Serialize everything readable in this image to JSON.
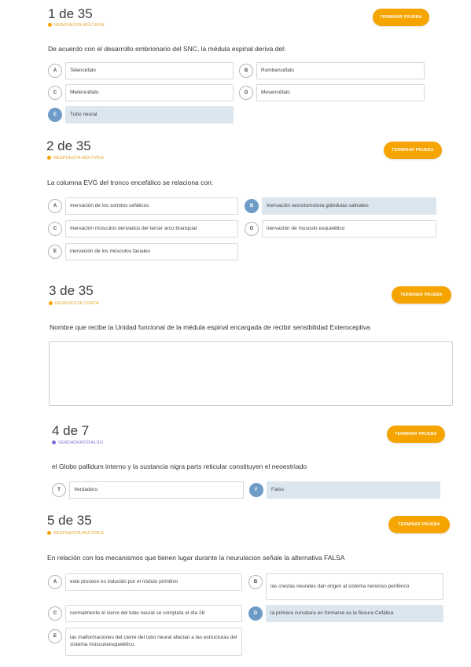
{
  "colors": {
    "accent": "#f5a400",
    "selected_circle": "#6e9bc7",
    "selected_bg": "#dce6ef",
    "truefalse_dot": "#7b6fd4"
  },
  "questions": [
    {
      "number": "1 de 35",
      "type": "RESPUESTA MÚLTIPLE",
      "button": "TERMINAR PRUEBA",
      "prompt": "De acuerdo con el desarrollo embrionario del SNC,  la médula espinal deriva del:",
      "options": [
        {
          "letter": "A",
          "text": "Telencéfalo",
          "selected": false
        },
        {
          "letter": "B",
          "text": "Rombencéfalo",
          "selected": false
        },
        {
          "letter": "C",
          "text": "Mielencéfalo",
          "selected": false
        },
        {
          "letter": "D",
          "text": "Mesencéfalo",
          "selected": false
        },
        {
          "letter": "E",
          "text": "Tubo neural",
          "selected": true
        }
      ]
    },
    {
      "number": "2 de 35",
      "type": "RESPUESTA MÚLTIPLE",
      "button": "TERMINAR PRUEBA",
      "prompt": "La columna EVG del tronco encefálico se relaciona con:",
      "options": [
        {
          "letter": "A",
          "text": "Inervación de los somitos cefálicos",
          "selected": false
        },
        {
          "letter": "B",
          "text": "Inervación secretomotora glándulas salivales",
          "selected": true
        },
        {
          "letter": "C",
          "text": "Inervación músculos derivados del tercer arco branquial",
          "selected": false
        },
        {
          "letter": "D",
          "text": "inervación de musculo esquelético",
          "selected": false
        },
        {
          "letter": "E",
          "text": "inervación de los músculos faciales",
          "selected": false
        }
      ]
    },
    {
      "number": "3 de 35",
      "type": "RESPUESTA CORTA",
      "button": "TERMINAR PRUEBA",
      "prompt": "Nombre que recibe la Unidad funcional de la médula espinal encargada de recibir sensibilidad Exteroceptiva",
      "answer": ""
    },
    {
      "number": "4 de 7",
      "type": "VERDADERO/FALSO",
      "button": "TERMINAR PRUEBA",
      "prompt": "el Globo pallidum interno y la sustancia nigra parts reticular constituyen el neoestriado",
      "options": [
        {
          "letter": "T",
          "text": "Verdadero",
          "selected": false
        },
        {
          "letter": "F",
          "text": "Falso",
          "selected": true
        }
      ]
    },
    {
      "number": "5 de 35",
      "type": "RESPUESTA MÚLTIPLE",
      "button": "TERMINAR PRUEBA",
      "prompt": "En relación con los mecanismos que tienen lugar durante la neurulacion señale la alternativa FALSA",
      "options": [
        {
          "letter": "A",
          "text": "este proceso es inducido por el nódulo primitivo",
          "selected": false
        },
        {
          "letter": "B",
          "text": "las crestas neurales dan origen al sistema nervioso periférico",
          "selected": false
        },
        {
          "letter": "C",
          "text": "normalmente el cierre del tubo neural se completa el día 28",
          "selected": false
        },
        {
          "letter": "D",
          "text": "la primera curvatura en formarse es la flexura Cefálica",
          "selected": true
        },
        {
          "letter": "E",
          "text": "las malformaciones del cierre del tubo neural afectan a las estructuras del sistema músculoesquelético.",
          "selected": false
        }
      ]
    }
  ]
}
